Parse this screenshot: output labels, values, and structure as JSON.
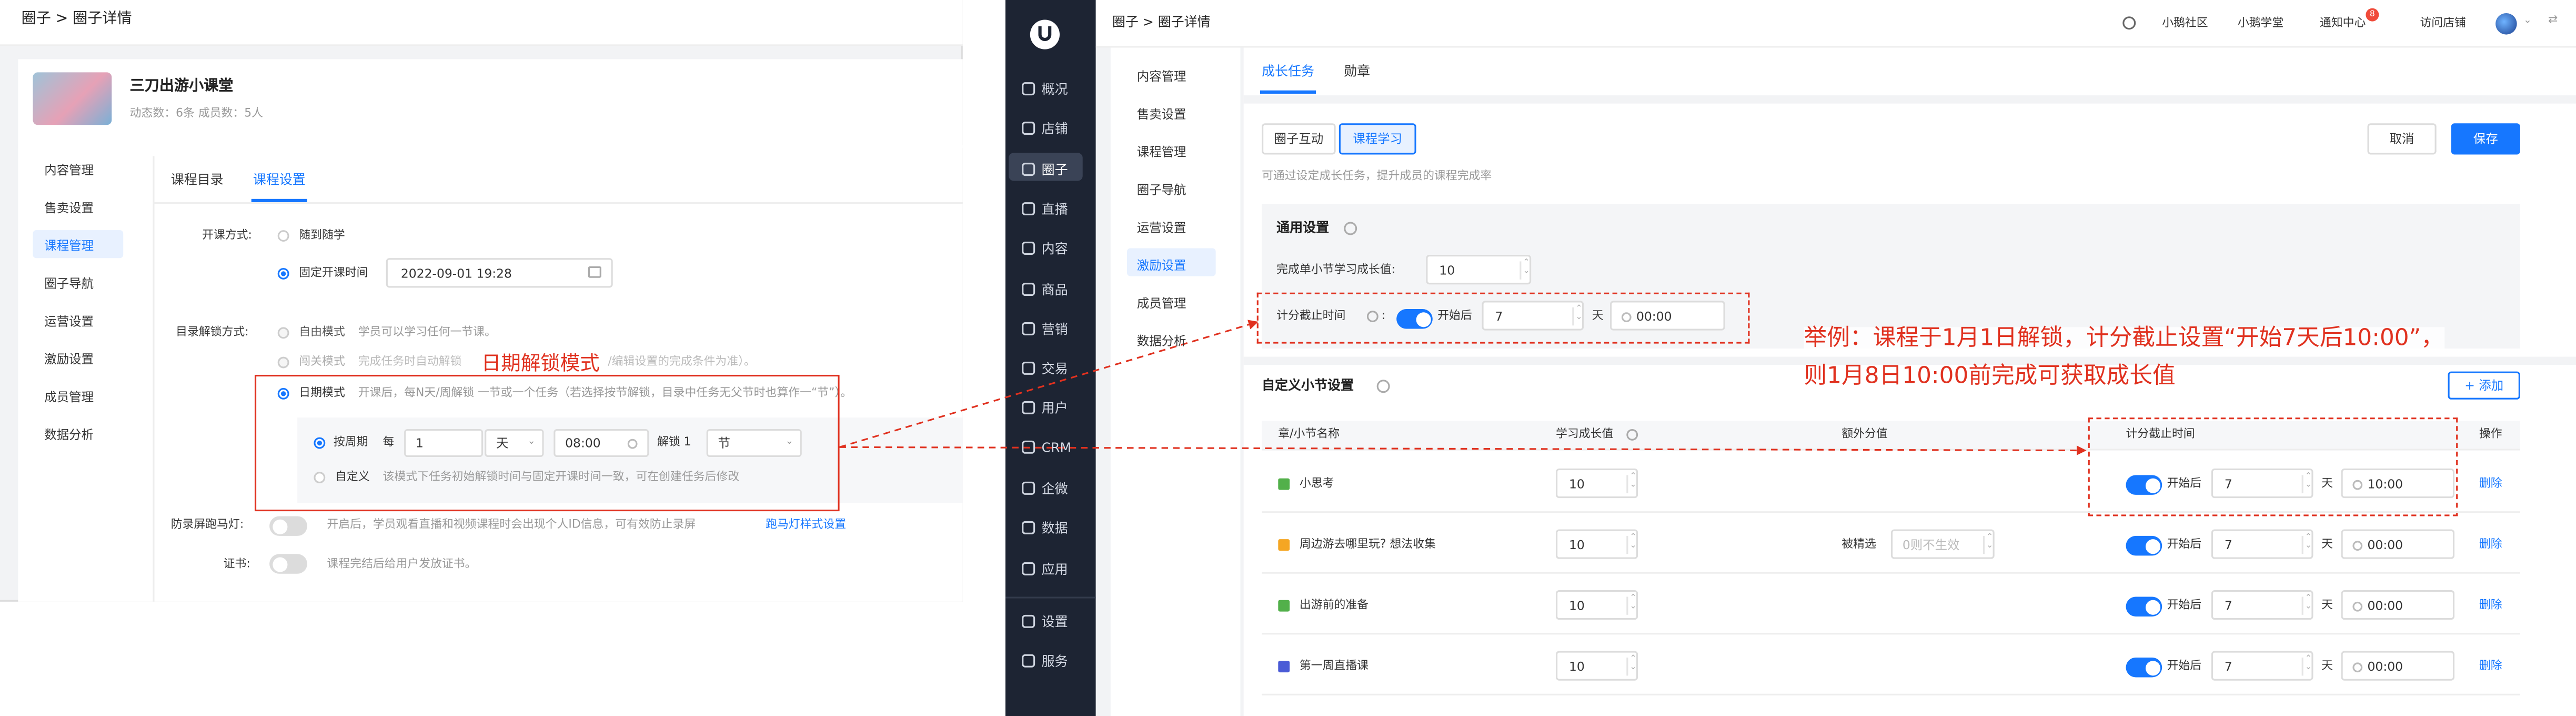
{
  "left": {
    "breadcrumb": "圈子 > 圈子详情",
    "circle_name": "三刀出游小课堂",
    "circle_stats": "动态数：6条    成员数：5人",
    "sidebar": [
      "内容管理",
      "售卖设置",
      "课程管理",
      "圈子导航",
      "运营设置",
      "激励设置",
      "成员管理",
      "数据分析"
    ],
    "tabs": [
      "课程目录",
      "课程设置"
    ],
    "open_label": "开课方式:",
    "open_options": [
      "随到随学",
      "固定开课时间"
    ],
    "open_date": "2022-09-01 19:28",
    "unlock_label": "目录解锁方式:",
    "free_mode": "自由模式",
    "free_desc": "学员可以学习任何一节课。",
    "pass_mode": "闯关模式",
    "pass_desc": "完成任务时自动解锁",
    "pass_desc2": "/编辑设置的完成条件为准）。",
    "date_mode": "日期模式",
    "date_desc": "开课后，每N天/周解锁 一节或一个任务（若选择按节解锁，目录中任务无父节时也算作一“节”）。",
    "by_cycle": "按周期",
    "every": "每",
    "every_value": "1",
    "unit": "天",
    "time": "08:00",
    "unlock_count_label": "解锁 1",
    "unlock_unit": "节",
    "custom": "自定义",
    "custom_desc": "该模式下任务初始解锁时间与固定开课时间一致，可在创建任务后修改",
    "marquee_label": "防录屏跑马灯:",
    "marquee_desc": "开启后，学员观看直播和视频课程时会出现个人ID信息，可有效防止录屏",
    "marquee_link": "跑马灯样式设置",
    "cert_label": "证书:",
    "cert_desc": "课程完结后给用户发放证书。",
    "annotation": "日期解锁模式"
  },
  "nav": {
    "items": [
      {
        "icon": "overview-icon",
        "label": "概况"
      },
      {
        "icon": "store-icon",
        "label": "店铺"
      },
      {
        "icon": "circle-icon",
        "label": "圈子"
      },
      {
        "icon": "live-icon",
        "label": "直播"
      },
      {
        "icon": "content-icon",
        "label": "内容"
      },
      {
        "icon": "goods-icon",
        "label": "商品"
      },
      {
        "icon": "marketing-icon",
        "label": "营销"
      },
      {
        "icon": "trade-icon",
        "label": "交易"
      },
      {
        "icon": "user-icon",
        "label": "用户"
      },
      {
        "icon": "crm-icon",
        "label": "CRM"
      },
      {
        "icon": "wecom-icon",
        "label": "企微"
      },
      {
        "icon": "data-icon",
        "label": "数据"
      },
      {
        "icon": "apps-icon",
        "label": "应用"
      },
      {
        "icon": "settings-icon",
        "label": "设置"
      },
      {
        "icon": "service-icon",
        "label": "服务"
      }
    ]
  },
  "right": {
    "breadcrumb": "圈子 > 圈子详情",
    "topbar": [
      "小鹅社区",
      "小鹅学堂",
      "通知中心",
      "访问店铺"
    ],
    "notice_badge": "8",
    "sidebar": [
      "内容管理",
      "售卖设置",
      "课程管理",
      "圈子导航",
      "运营设置",
      "激励设置",
      "成员管理",
      "数据分析"
    ],
    "tabs": [
      "成长任务",
      "勋章"
    ],
    "subtabs": [
      "圈子互动",
      "课程学习"
    ],
    "cancel": "取消",
    "save": "保存",
    "hint": "可通过设定成长任务，提升成员的课程完成率",
    "general_title": "通用设置",
    "single_label": "完成单小节学习成长值:",
    "single_value": "10",
    "deadline_label": "计分截止时间",
    "start_after": "开始后",
    "days": "7",
    "day_unit": "天",
    "time": "00:00",
    "custom_title": "自定义小节设置",
    "add": "+ 添加",
    "columns": [
      "章/小节名称",
      "学习成长值",
      "额外分值",
      "计分截止时间",
      "操作"
    ],
    "rows": [
      {
        "name": "小思考",
        "growth": "10",
        "extra_label": "",
        "extra": "",
        "days": "7",
        "time": "10:00",
        "op": "删除",
        "color": "#52b04a"
      },
      {
        "name": "周边游去哪里玩? 想法收集",
        "growth": "10",
        "extra_label": "被精选",
        "extra": "0则不生效",
        "days": "7",
        "time": "00:00",
        "op": "删除",
        "color": "#f5a623"
      },
      {
        "name": "出游前的准备",
        "growth": "10",
        "extra_label": "",
        "extra": "",
        "days": "7",
        "time": "00:00",
        "op": "删除",
        "color": "#52b04a"
      },
      {
        "name": "第一周直播课",
        "growth": "10",
        "extra_label": "",
        "extra": "",
        "days": "7",
        "time": "00:00",
        "op": "删除",
        "color": "#4a5bd6"
      }
    ],
    "annotation_line1": "举例：课程于1月1日解锁，计分截止设置“开始7天后10:00”，",
    "annotation_line2": "则1月8日10:00前完成可获取成长值"
  },
  "colors": {
    "accent": "#1677ff",
    "nav_bg": "#1d2433",
    "annotation": "#e0311f"
  }
}
